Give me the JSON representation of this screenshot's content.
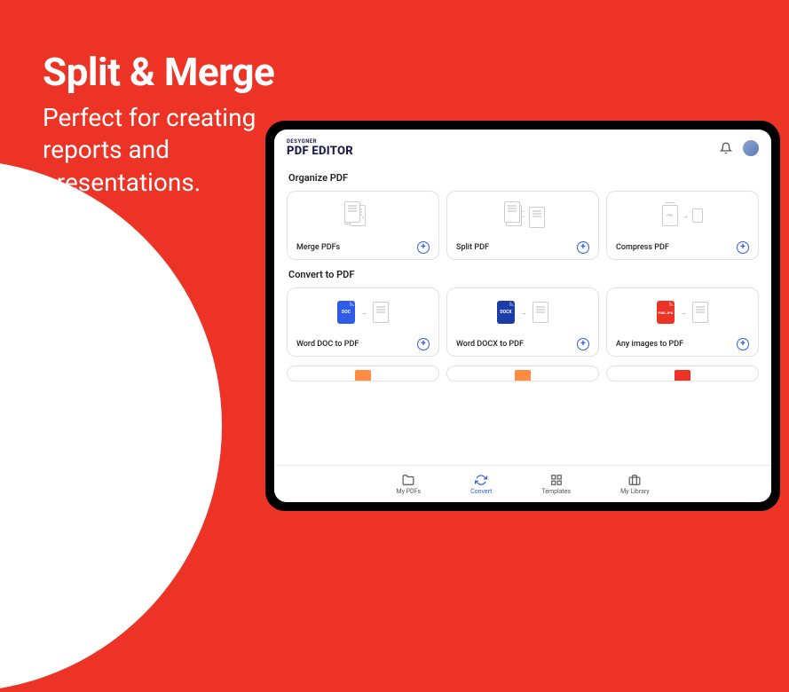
{
  "headline": {
    "title": "Split & Merge",
    "subtitle_line1": "Perfect for creating",
    "subtitle_line2": "reports and",
    "subtitle_line3": "presentations."
  },
  "header": {
    "brand_small": "DESYGNER",
    "brand_big": "PDF EDITOR"
  },
  "sections": [
    {
      "title": "Organize PDF",
      "cards": [
        {
          "label": "Merge PDFs"
        },
        {
          "label": "Split PDF"
        },
        {
          "label": "Compress PDF"
        }
      ]
    },
    {
      "title": "Convert to PDF",
      "cards": [
        {
          "label": "Word DOC to PDF"
        },
        {
          "label": "Word DOCX to PDF"
        },
        {
          "label": "Any images to PDF"
        }
      ]
    }
  ],
  "nav": [
    {
      "label": "My PDFs",
      "active": false
    },
    {
      "label": "Convert",
      "active": true
    },
    {
      "label": "Templates",
      "active": false
    },
    {
      "label": "My Library",
      "active": false
    }
  ],
  "file_labels": {
    "doc": "DOC",
    "docx": "DOCX",
    "img": "PNG\nJPG"
  }
}
